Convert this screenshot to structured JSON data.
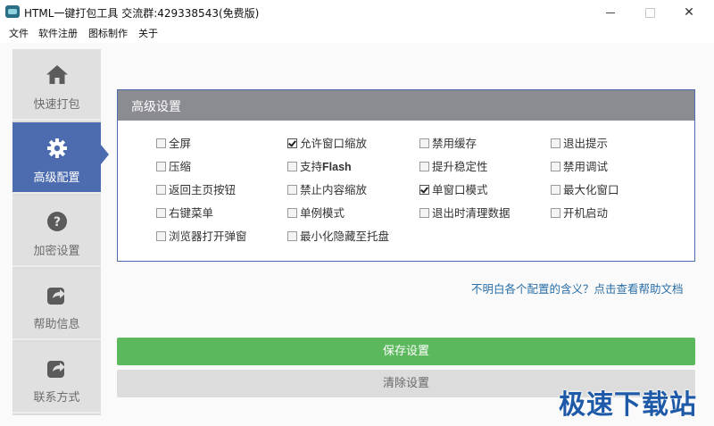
{
  "window": {
    "title": "HTML一键打包工具 交流群:429338543(免费版)"
  },
  "menu": [
    "文件",
    "软件注册",
    "图标制作",
    "关于"
  ],
  "sidebar": {
    "items": [
      {
        "label": "快速打包",
        "icon": "home-icon"
      },
      {
        "label": "高级配置",
        "icon": "gear-icon",
        "active": true
      },
      {
        "label": "加密设置",
        "icon": "question-icon"
      },
      {
        "label": "帮助信息",
        "icon": "share-icon"
      },
      {
        "label": "联系方式",
        "icon": "share-icon"
      }
    ]
  },
  "panel": {
    "title": "高级设置",
    "options": [
      {
        "label": "全屏",
        "checked": false
      },
      {
        "label": "允许窗口缩放",
        "checked": true
      },
      {
        "label": "禁用缓存",
        "checked": false
      },
      {
        "label": "退出提示",
        "checked": false
      },
      {
        "label": "压缩",
        "checked": false
      },
      {
        "label_prefix": "支持",
        "label_bold": "Flash",
        "checked": false
      },
      {
        "label": "提升稳定性",
        "checked": false
      },
      {
        "label": "禁用调试",
        "checked": false
      },
      {
        "label": "返回主页按钮",
        "checked": false
      },
      {
        "label": "禁止内容缩放",
        "checked": false
      },
      {
        "label": "单窗口模式",
        "checked": true
      },
      {
        "label": "最大化窗口",
        "checked": false
      },
      {
        "label": "右键菜单",
        "checked": false
      },
      {
        "label": "单例模式",
        "checked": false
      },
      {
        "label": "退出时清理数据",
        "checked": false
      },
      {
        "label": "开机启动",
        "checked": false
      },
      {
        "label": "浏览器打开弹窗",
        "checked": false
      },
      {
        "label": "最小化隐藏至托盘",
        "checked": false
      }
    ]
  },
  "help_link": "不明白各个配置的含义？点击查看帮助文档",
  "buttons": {
    "save": "保存设置",
    "clear": "清除设置"
  },
  "watermark": "极速下载站",
  "colors": {
    "accent": "#4d6cb0",
    "panel_header": "#8b8b92",
    "save_button": "#5cb85c",
    "clear_button": "#dcdcdc",
    "link": "#2a6fa8"
  }
}
